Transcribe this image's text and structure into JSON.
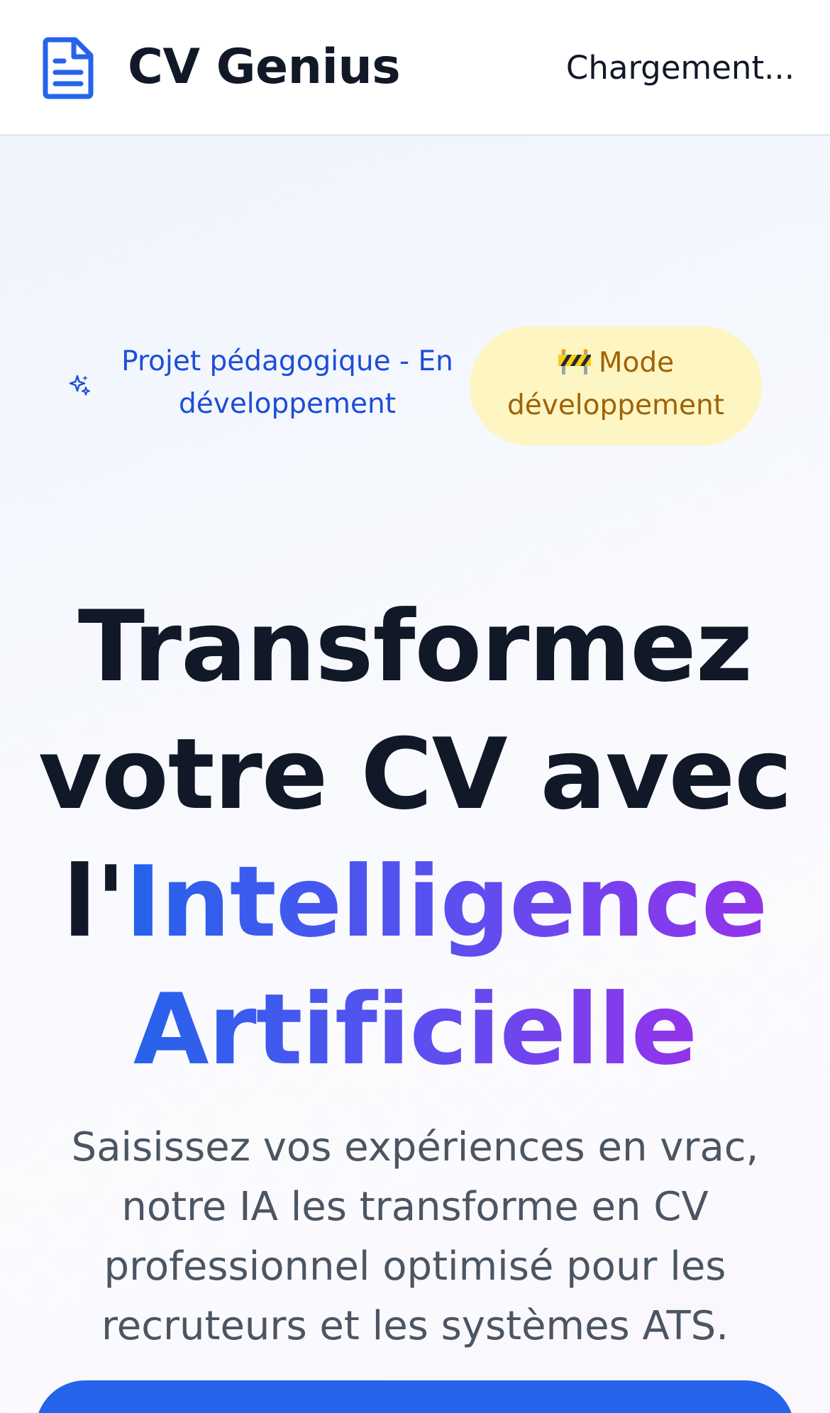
{
  "header": {
    "brand": "CV Genius",
    "loading_text": "Chargement...",
    "logo_icon": "document-icon"
  },
  "hero": {
    "project_label": "Projet pédagogique - En développement",
    "dev_badge_label": "Mode développement",
    "dev_badge_icon": "construction-barrier-icon",
    "sparkle_icon": "sparkles-icon",
    "title_line1": "Transformez",
    "title_line2": "votre CV avec",
    "title_prefix": "l'",
    "title_highlight_line1": "Intelligence",
    "title_highlight_line2": "Artificielle",
    "subtitle": "Saisissez vos expériences en vrac, notre IA les transforme en CV professionnel optimisé pour les recruteurs et les systèmes ATS."
  },
  "colors": {
    "accent": "#2563eb",
    "gradient_end": "#9333ea",
    "badge_bg": "#fdf6c3",
    "badge_text": "#a16207"
  }
}
